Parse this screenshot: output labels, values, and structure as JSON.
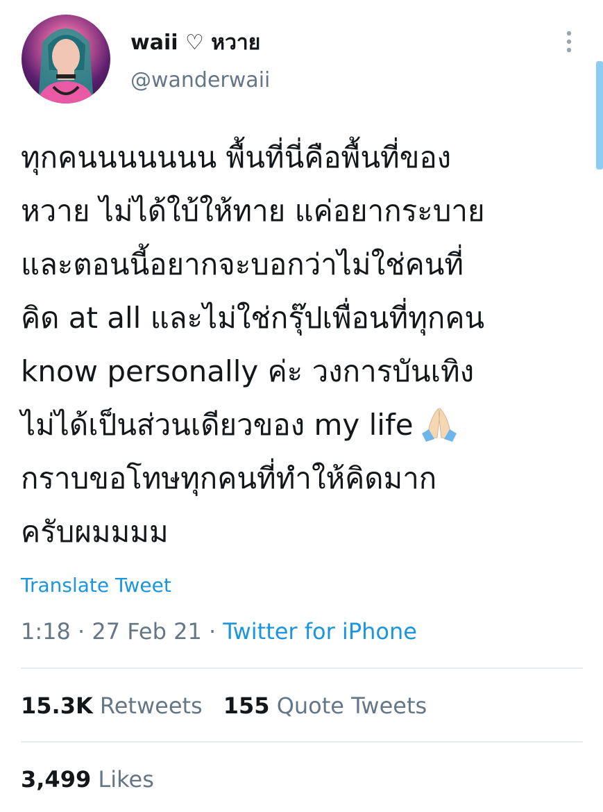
{
  "user": {
    "display_name": "waii ♡ หวาย",
    "handle": "@wanderwaii"
  },
  "tweet": {
    "text": "ทุกคนนนนนนน พื้นที่นี่คือพื้นที่ของ\nหวาย ไม่ได้ใบ้ให้ทาย แค่อยากระบาย\nและตอนนี้อยากจะบอกว่าไม่ใช่คนที่\nคิด at all และไม่ใช่กรุ๊ปเพื่อนที่ทุกคน\nknow personally ค่ะ วงการบันเทิง\nไม่ได้เป็นส่วนเดียวของ my life",
    "text_after_emoji": "กราบขอโทษทุกคนที่ทำให้คิดมาก\nครับผมมมม",
    "emoji_icon": "folded-hands-emoji",
    "translate_label": "Translate Tweet"
  },
  "meta": {
    "time": "1:18",
    "separator": " · ",
    "date": "27 Feb 21",
    "source": "Twitter for iPhone"
  },
  "stats": {
    "retweets_count": "15.3K",
    "retweets_label": "Retweets",
    "quotes_count": "155",
    "quotes_label": "Quote Tweets",
    "likes_count": "3,499",
    "likes_label": "Likes"
  },
  "colors": {
    "link": "#1b95e0",
    "secondary_text": "#657786",
    "primary_text": "#14171a",
    "divider": "#e6ecf0"
  }
}
